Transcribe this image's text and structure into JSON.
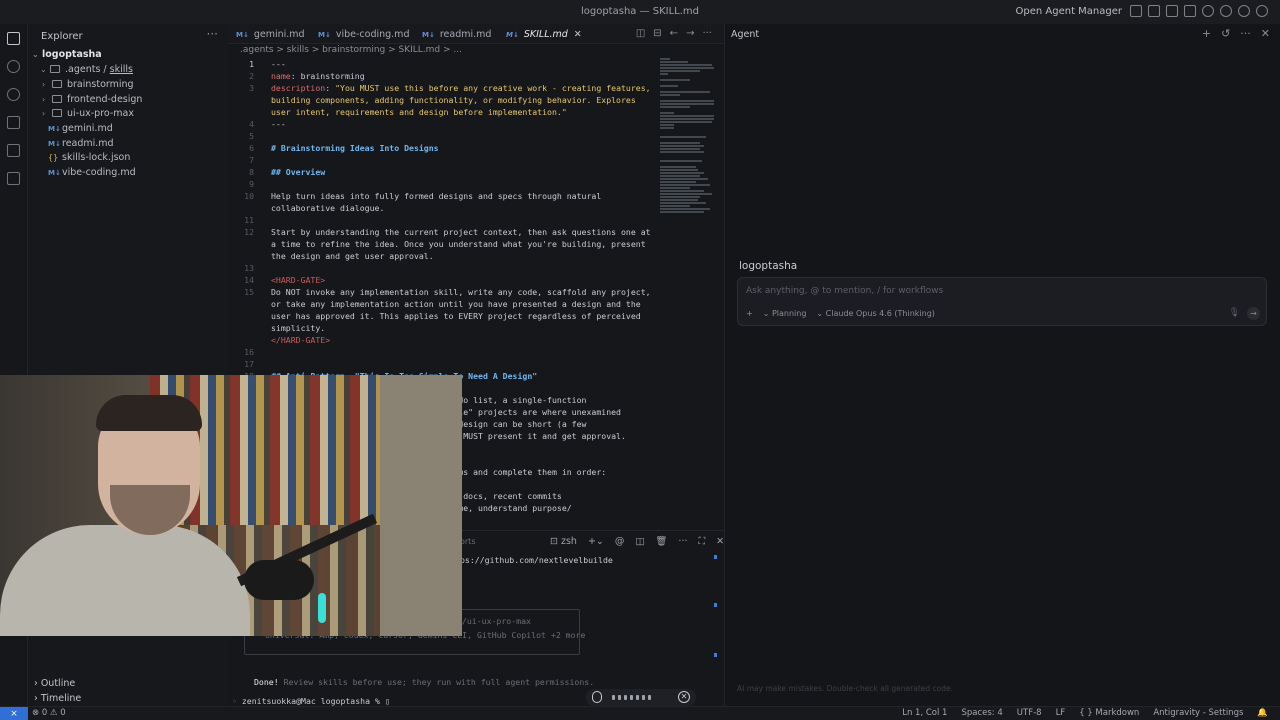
{
  "window": {
    "title": "logoptasha — SKILL.md",
    "open_agent_manager": "Open Agent Manager"
  },
  "explorer": {
    "title": "Explorer",
    "more": "···",
    "root": "logoptasha",
    "agents_folder": ".agents / ",
    "skills_folder": "skills",
    "items": [
      {
        "label": "brainstorming",
        "kind": "folder"
      },
      {
        "label": "frontend-design",
        "kind": "folder"
      },
      {
        "label": "ui-ux-pro-max",
        "kind": "folder"
      },
      {
        "label": "gemini.md",
        "kind": "md"
      },
      {
        "label": "readmi.md",
        "kind": "md"
      },
      {
        "label": "skills-lock.json",
        "kind": "json"
      },
      {
        "label": "vibe-coding.md",
        "kind": "md"
      }
    ],
    "outline": "Outline",
    "timeline": "Timeline"
  },
  "tabs": [
    {
      "label": "gemini.md"
    },
    {
      "label": "vibe-coding.md"
    },
    {
      "label": "readmi.md"
    },
    {
      "label": "SKILL.md",
      "active": true
    }
  ],
  "breadcrumb": ".agents  >  skills  >  brainstorming  >  SKILL.md  >  ...",
  "code_lines": [
    {
      "n": "1",
      "t": "---"
    },
    {
      "n": "2",
      "k": "name",
      "v": ": brainstorming"
    },
    {
      "n": "3",
      "k": "description",
      "v": ": \"You MUST use this before any creative work - creating features,"
    },
    {
      "n": "",
      "s": "building components, adding functionality, or modifying behavior. Explores"
    },
    {
      "n": "",
      "s": "user intent, requirements and design before implementation.\""
    },
    {
      "n": "4",
      "t": "---"
    },
    {
      "n": "5",
      "t": ""
    },
    {
      "n": "6",
      "h": "# Brainstorming Ideas Into Designs"
    },
    {
      "n": "7",
      "t": ""
    },
    {
      "n": "8",
      "h": "## Overview"
    },
    {
      "n": "9",
      "t": ""
    },
    {
      "n": "10",
      "t": "Help turn ideas into fully formed designs and specs through natural"
    },
    {
      "n": "",
      "t": "collaborative dialogue."
    },
    {
      "n": "11",
      "t": ""
    },
    {
      "n": "12",
      "t": "Start by understanding the current project context, then ask questions one at"
    },
    {
      "n": "",
      "t": "a time to refine the idea. Once you understand what you're building, present"
    },
    {
      "n": "",
      "t": "the design and get user approval."
    },
    {
      "n": "13",
      "t": ""
    },
    {
      "n": "14",
      "g": "<HARD-GATE>"
    },
    {
      "n": "15",
      "t": "Do NOT invoke any implementation skill, write any code, scaffold any project,"
    },
    {
      "n": "",
      "t": "or take any implementation action until you have presented a design and the"
    },
    {
      "n": "",
      "t": "user has approved it. This applies to EVERY project regardless of perceived"
    },
    {
      "n": "",
      "t": "simplicity."
    },
    {
      "n": "",
      "g": "</HARD-GATE>"
    },
    {
      "n": "16",
      "t": ""
    },
    {
      "n": "17",
      "t": ""
    },
    {
      "n": "18",
      "h": "## Anti-Pattern: \"This Is Too Simple To Need A Design\""
    },
    {
      "n": "",
      "t": ""
    },
    {
      "n": "",
      "t": "                                  A todo list, a single-function"
    },
    {
      "n": "",
      "t": "                                 \"Simple\" projects are where unexamined"
    },
    {
      "n": "",
      "t": "                                  The design can be short (a few"
    },
    {
      "n": "",
      "t": "                                 t you MUST present it and get approval."
    },
    {
      "n": "",
      "t": ""
    },
    {
      "n": "",
      "t": ""
    },
    {
      "n": "",
      "t": "                                 e items and complete them in order:"
    },
    {
      "n": "",
      "t": ""
    },
    {
      "n": "",
      "t": "                                 iles, docs, recent commits"
    },
    {
      "n": "",
      "t": "                                  a time, understand purpose/"
    }
  ],
  "terminal": {
    "ports_tab": "orts",
    "shell": "zsh",
    "url_line": "ps://github.com/nextlevelbuilde",
    "box_line1": "i/ui-ux-pro-max",
    "box_line2": "Universal: Amp, Codex, Cursor, Gemini CLI, GitHub Copilot +2 more",
    "done_label": "Done!",
    "done_text": " Review skills before use; they run with full agent permissions.",
    "prompt": "zenitsuokka@Mac logoptasha % "
  },
  "agent": {
    "title": "Agent",
    "workspace": "logoptasha",
    "placeholder": "Ask anything, @ to mention, / for workflows",
    "add": "+",
    "mode": "Planning",
    "model": "Claude Opus 4.6 (Thinking)",
    "disclaimer": "AI may make mistakes. Double-check all generated code."
  },
  "status": {
    "remote": "⨯",
    "problems": "⊗ 0  ⚠ 0",
    "position": "Ln 1, Col 1",
    "spaces": "Spaces: 4",
    "encoding": "UTF-8",
    "eol": "LF",
    "language": "{ } Markdown",
    "settings": "Antigravity - Settings"
  },
  "colors": {
    "accent": "#2f6fd6",
    "yaml_key": "#d96a6a",
    "yaml_string": "#e6c76a",
    "heading": "#6fb7f0"
  }
}
